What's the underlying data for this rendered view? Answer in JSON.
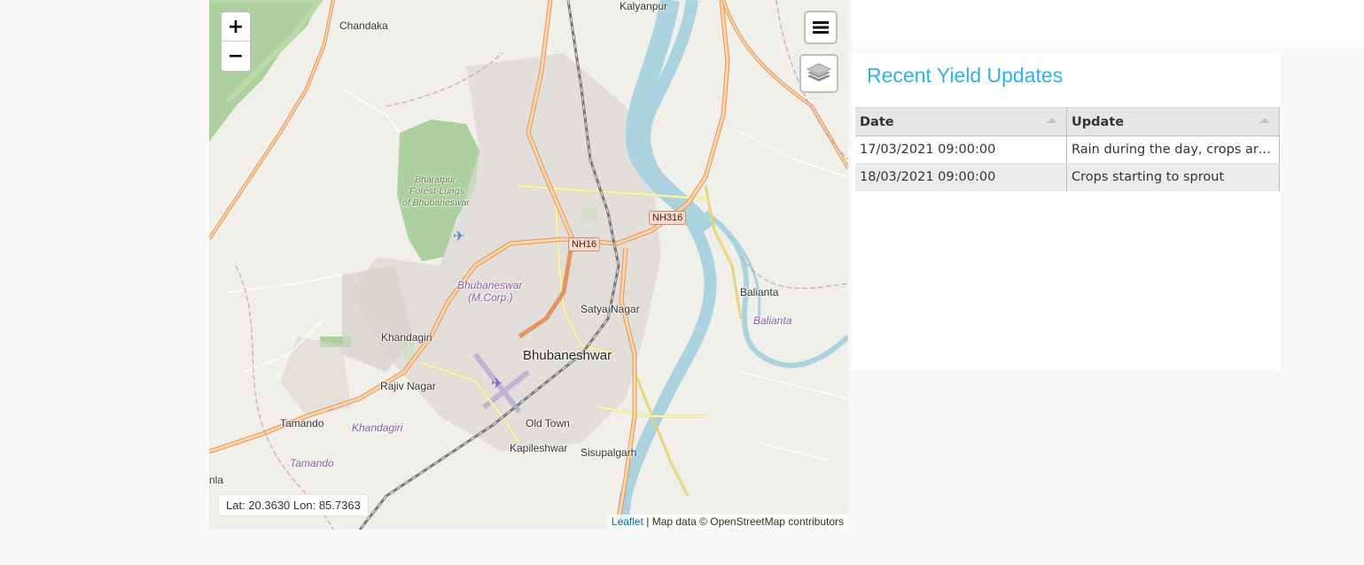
{
  "map": {
    "zoom_in": "+",
    "zoom_out": "−",
    "coords_text": "Lat: 20.3630  Lon: 85.7363",
    "attribution": {
      "leaflet": "Leaflet",
      "rest": " | Map data © OpenStreetMap contributors"
    },
    "places": {
      "kalyanpur": "Kalyanpur",
      "chandaka": "Chandaka",
      "forest_line1": "Bharatpur",
      "forest_line2": "Forest-Lungs",
      "forest_line3": "of Bhubaneswar",
      "nh16": "NH16",
      "nh316": "NH316",
      "bbsr_corp_line1": "Bhubaneswar",
      "bbsr_corp_line2": "(M.Corp.)",
      "satya_nagar": "Satya Nagar",
      "balianta": "Balianta",
      "balianta_area": "Balianta",
      "khandagiri": "Khandagiri",
      "bhubaneshwar": "Bhubaneshwar",
      "rajiv_nagar": "Rajiv Nagar",
      "tamando": "Tamando",
      "khandagiri_area": "Khandagiri",
      "old_town": "Old Town",
      "tamando_area": "Tamando",
      "kapileshwar": "Kapileshwar",
      "sisupalgarh": "Sisupalgarh",
      "nla": "nla"
    },
    "colors": {
      "river": "#aad3df",
      "forest": "#add19e",
      "trunk": "#f0a57c",
      "secondary": "#f7fabf",
      "rail": "#777777"
    },
    "icons": {
      "menu": "hamburger-menu-icon",
      "layers": "layers-icon"
    }
  },
  "yield": {
    "title": "Recent Yield Updates",
    "columns": [
      "Date",
      "Update"
    ],
    "rows": [
      {
        "date": "17/03/2021 09:00:00",
        "update": "Rain during the day, crops are ..."
      },
      {
        "date": "18/03/2021 09:00:00",
        "update": "Crops starting to sprout"
      }
    ]
  }
}
